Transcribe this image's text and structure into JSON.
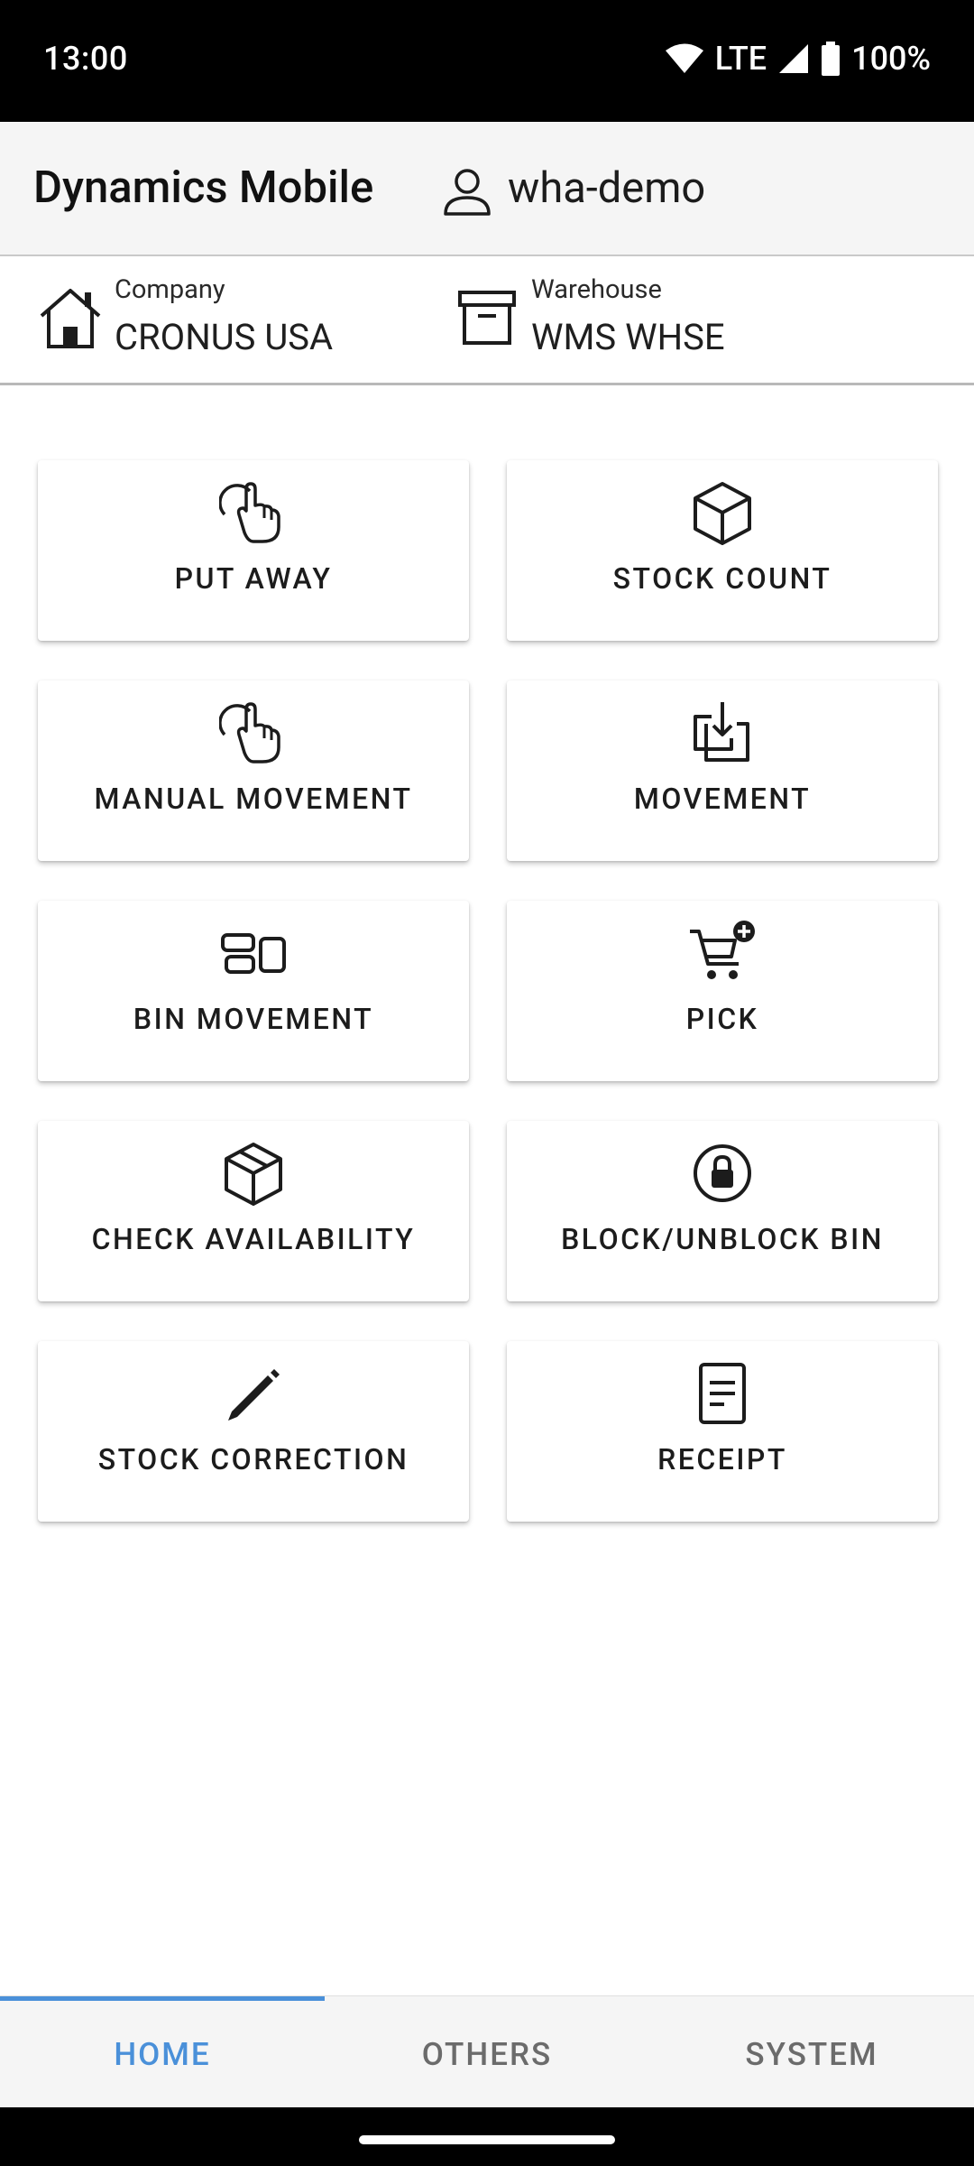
{
  "status_bar": {
    "time": "13:00",
    "network": "LTE",
    "battery": "100%"
  },
  "app_bar": {
    "title": "Dynamics Mobile",
    "user": "wha-demo"
  },
  "context": {
    "company_label": "Company",
    "company_value": "CRONUS USA",
    "warehouse_label": "Warehouse",
    "warehouse_value": "WMS WHSE"
  },
  "tiles": [
    {
      "label": "PUT AWAY",
      "icon": "hand-pointer-icon"
    },
    {
      "label": "STOCK COUNT",
      "icon": "cube-icon"
    },
    {
      "label": "MANUAL MOVEMENT",
      "icon": "hand-pointer-icon"
    },
    {
      "label": "MOVEMENT",
      "icon": "import-box-icon"
    },
    {
      "label": "BIN MOVEMENT",
      "icon": "bins-layout-icon"
    },
    {
      "label": "PICK",
      "icon": "cart-plus-icon"
    },
    {
      "label": "CHECK AVAILABILITY",
      "icon": "package-icon"
    },
    {
      "label": "BLOCK/UNBLOCK BIN",
      "icon": "lock-circle-icon"
    },
    {
      "label": "STOCK CORRECTION",
      "icon": "pencil-icon"
    },
    {
      "label": "RECEIPT",
      "icon": "document-icon"
    }
  ],
  "bottom_nav": {
    "tabs": [
      {
        "label": "HOME",
        "active": true
      },
      {
        "label": "OTHERS",
        "active": false
      },
      {
        "label": "SYSTEM",
        "active": false
      }
    ],
    "accent_color": "#4a90d9"
  }
}
